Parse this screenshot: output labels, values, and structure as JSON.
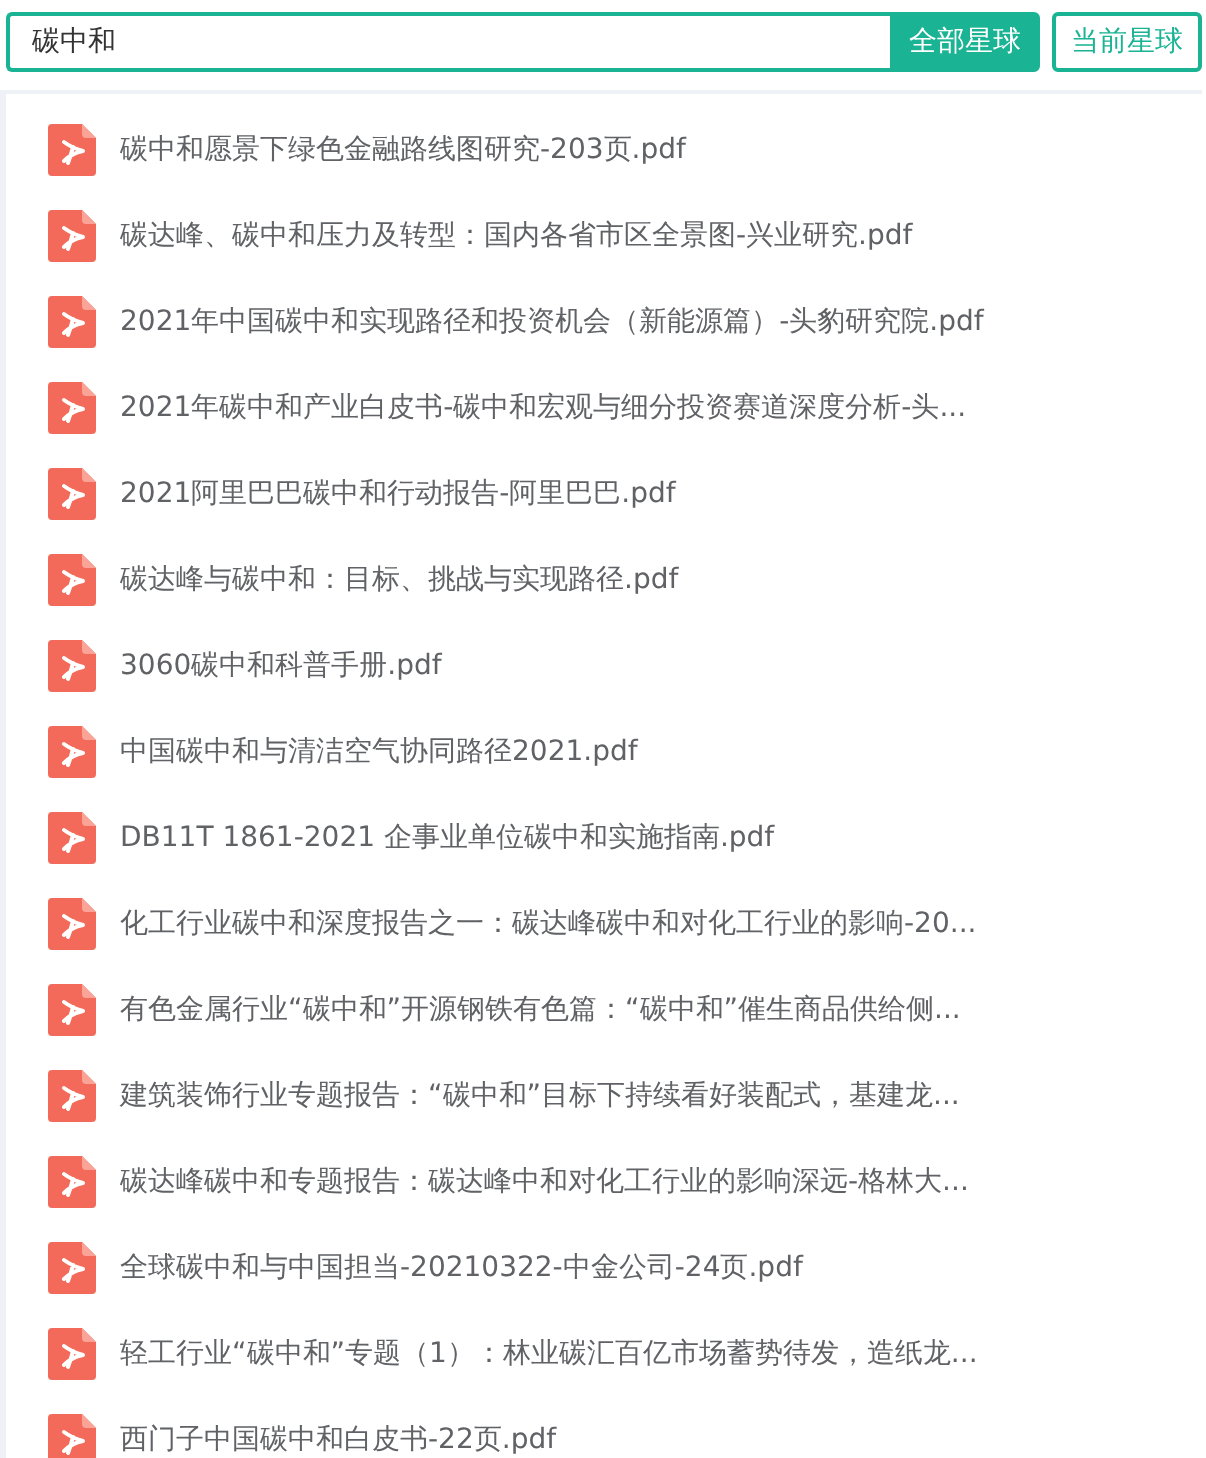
{
  "search": {
    "value": "碳中和"
  },
  "buttons": [
    {
      "label": "全部星球",
      "kind": "filled"
    },
    {
      "label": "当前星球",
      "kind": "outlined"
    }
  ],
  "files": [
    {
      "name": "碳中和愿景下绿色金融路线图研究-203页.pdf"
    },
    {
      "name": "碳达峰、碳中和压力及转型：国内各省市区全景图-兴业研究.pdf"
    },
    {
      "name": "2021年中国碳中和实现路径和投资机会（新能源篇）-头豹研究院.pdf"
    },
    {
      "name": "2021年碳中和产业白皮书-碳中和宏观与细分投资赛道深度分析-头..."
    },
    {
      "name": "2021阿里巴巴碳中和行动报告-阿里巴巴.pdf"
    },
    {
      "name": "碳达峰与碳中和：目标、挑战与实现路径.pdf"
    },
    {
      "name": "3060碳中和科普手册.pdf"
    },
    {
      "name": "中国碳中和与清洁空气协同路径2021.pdf"
    },
    {
      "name": "DB11T 1861-2021 企事业单位碳中和实施指南.pdf"
    },
    {
      "name": "化工行业碳中和深度报告之一：碳达峰碳中和对化工行业的影响-20..."
    },
    {
      "name": "有色金属行业“碳中和”开源钢铁有色篇：“碳中和”催生商品供给侧..."
    },
    {
      "name": "建筑装饰行业专题报告：“碳中和”目标下持续看好装配式，基建龙..."
    },
    {
      "name": "碳达峰碳中和专题报告：碳达峰中和对化工行业的影响深远-格林大..."
    },
    {
      "name": "全球碳中和与中国担当-20210322-中金公司-24页.pdf"
    },
    {
      "name": "轻工行业“碳中和”专题（1）：林业碳汇百亿市场蓄势待发，造纸龙..."
    },
    {
      "name": "西门子中国碳中和白皮书-22页.pdf"
    }
  ]
}
